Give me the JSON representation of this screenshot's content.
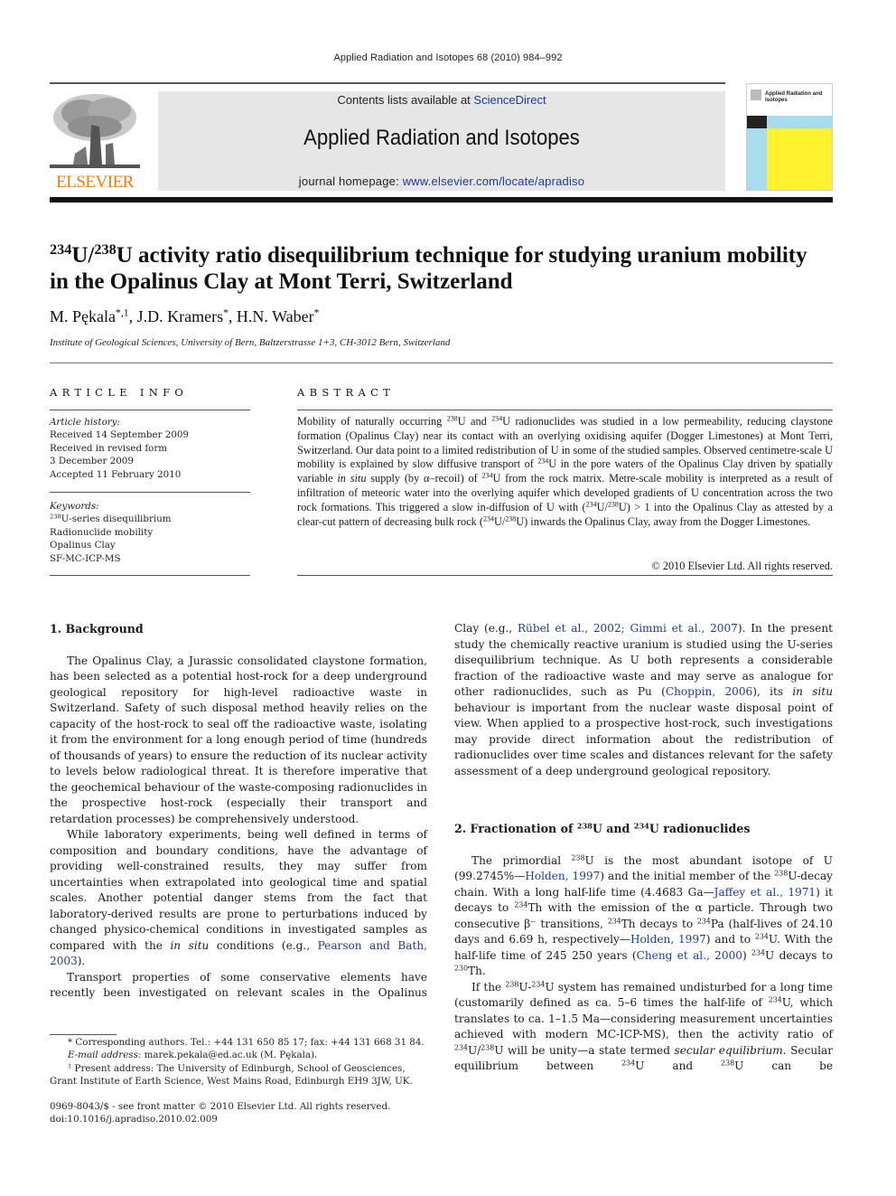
{
  "running_head": "Applied Radiation and Isotopes 68 (2010) 984–992",
  "masthead": {
    "publisher_logo_text": "ELSEVIER",
    "contents_prefix": "Contents lists available at ",
    "contents_link": "ScienceDirect",
    "journal_title": "Applied Radiation and Isotopes",
    "homepage_prefix": "journal homepage: ",
    "homepage_link": "www.elsevier.com/locate/apradiso",
    "cover_title": "Applied Radiation and Isotopes",
    "colors": {
      "elsevier_orange": "#f07d00",
      "link_blue": "#1f3a93",
      "banner_gray": "#e6e6e6",
      "cover_blue": "#a8dcef",
      "cover_yellow": "#fff22e"
    }
  },
  "article": {
    "title_sup1": "234",
    "title_u1": "U/",
    "title_sup2": "238",
    "title_rest": "U activity ratio disequilibrium technique for studying uranium mobility in the Opalinus Clay at Mont Terri, Switzerland",
    "authors": [
      {
        "name": "M. Pękala",
        "marks": "*,1"
      },
      {
        "name": "J.D. Kramers",
        "marks": "*"
      },
      {
        "name": "H.N. Waber",
        "marks": "*"
      }
    ],
    "affiliation": "Institute of Geological Sciences, University of Bern, Baltzerstrasse 1+3, CH-3012 Bern, Switzerland"
  },
  "article_info": {
    "heading": "ARTICLE INFO",
    "history_label": "Article history:",
    "history": [
      "Received 14 September 2009",
      "Received in revised form",
      "3 December 2009",
      "Accepted 11 February 2010"
    ],
    "keywords_label": "Keywords:",
    "keyword_sup": "238",
    "keywords": [
      "U-series disequilibrium",
      "Radionuclide mobility",
      "Opalinus Clay",
      "SF-MC-ICP-MS"
    ]
  },
  "abstract": {
    "heading": "ABSTRACT",
    "t1": "Mobility of naturally occurring ",
    "s1": "238",
    "t2": "U and ",
    "s2": "234",
    "t3": "U radionuclides was studied in a low permeability, reducing claystone formation (Opalinus Clay) near its contact with an overlying oxidising aquifer (Dogger Limestones) at Mont Terri, Switzerland. Our data point to a limited redistribution of U in some of the studied samples. Observed centimetre-scale U mobility is explained by slow diffusive transport of ",
    "s3": "234",
    "t4": "U in the pore waters of the Opalinus Clay driven by spatially variable ",
    "i1": "in situ",
    "t5": " supply (by α–recoil) of ",
    "s4": "234",
    "t6": "U from the rock matrix. Metre-scale mobility is interpreted as a result of infiltration of meteoric water into the overlying aquifer which developed gradients of U concentration across the two rock formations. This triggered a slow in-diffusion of U with (",
    "s5": "234",
    "t7": "U/",
    "s6": "238",
    "t8": "U) > 1 into the Opalinus Clay as attested by a clear-cut pattern of decreasing bulk rock (",
    "s7": "234",
    "t9": "U/",
    "s8": "238",
    "t10": "U) inwards the Opalinus Clay, away from the Dogger Limestones.",
    "copyright": "© 2010 Elsevier Ltd. All rights reserved."
  },
  "section1": {
    "heading": "1.  Background",
    "p1": "The Opalinus Clay, a Jurassic consolidated claystone formation, has been selected as a potential host-rock for a deep underground geological repository for high-level radioactive waste in Switzerland. Safety of such disposal method heavily relies on the capacity of the host-rock to seal off the radioactive waste, isolating it from the environment for a long enough period of time (hundreds of thousands of years) to ensure the reduction of its nuclear activity to levels below radiological threat. It is therefore imperative that the geochemical behaviour of the waste-composing radionuclides in the prospective host-rock (especially their transport and retardation processes) be comprehensively understood.",
    "p2a": "While laboratory experiments, being well defined in terms of composition and boundary conditions, have the advantage of providing well-constrained results, they may suffer from uncertainties when extrapolated into geological time and spatial scales. Another potential danger stems from the fact that laboratory-derived results are prone to perturbations induced by changed physico-chemical conditions in investigated samples as compared with the ",
    "p2_italic": "in situ",
    "p2b": " conditions (e.g., ",
    "p2_ref": "Pearson and Bath, 2003",
    "p2c": ").",
    "p3": "Transport properties of some conservative elements have recently been investigated on relevant scales in the Opalinus",
    "p3_cont_a": "Clay (e.g., ",
    "p3_ref1": "Rübel et al., 2002; Gimmi et al., 2007",
    "p3_cont_b": "). In the present study the chemically reactive uranium is studied using the U-series disequilibrium technique. As U both represents a considerable fraction of the radioactive waste and may serve as analogue for other radionuclides, such as Pu (",
    "p3_ref2": "Choppin, 2006",
    "p3_cont_c": "), its ",
    "p3_italic": "in situ",
    "p3_cont_d": " behaviour is important from the nuclear waste disposal point of view. When applied to a prospective host-rock, such investigations may provide direct information about the redistribution of radionuclides over time scales and distances relevant for the safety assessment of a deep underground geological repository."
  },
  "section2": {
    "heading_a": "2.  Fractionation of ",
    "heading_s1": "238",
    "heading_b": "U and ",
    "heading_s2": "234",
    "heading_c": "U radionuclides",
    "p1_a": "The primordial ",
    "p1_s1": "238",
    "p1_b": "U is the most abundant isotope of U (99.2745%—",
    "p1_ref1": "Holden, 1997",
    "p1_c": ") and the initial member of the ",
    "p1_s2": "238",
    "p1_d": "U-decay chain. With a long half-life time (4.4683 Ga—",
    "p1_ref2": "Jaffey et al., 1971",
    "p1_e": ") it decays to ",
    "p1_s3": "234",
    "p1_f": "Th with the emission of the α particle. Through two consecutive β⁻ transitions, ",
    "p1_s4": "234",
    "p1_g": "Th decays to ",
    "p1_s5": "234",
    "p1_h": "Pa (half-lives of 24.10 days and 6.69 h, respectively—",
    "p1_ref3": "Holden, 1997",
    "p1_i": ") and to ",
    "p1_s6": "234",
    "p1_j": "U. With the half-life time of 245 250 years (",
    "p1_ref4": "Cheng et al., 2000",
    "p1_k": ") ",
    "p1_s7": "234",
    "p1_l": "U decays to ",
    "p1_s8": "230",
    "p1_m": "Th.",
    "p2_a": "If the ",
    "p2_s1": "238",
    "p2_b": "U-",
    "p2_s2": "234",
    "p2_c": "U system has remained undisturbed for a long time (customarily defined as ca. 5–6 times the half-life of ",
    "p2_s3": "234",
    "p2_d": "U, which translates to ca. 1–1.5 Ma—considering measurement uncertainties achieved with modern MC-ICP-MS), then the activity ratio of ",
    "p2_s4": "234",
    "p2_e": "U/",
    "p2_s5": "238",
    "p2_f": "U will be unity—a state termed ",
    "p2_italic": "secular equilibrium",
    "p2_g": ". Secular equilibrium between ",
    "p2_s6": "234",
    "p2_h": "U and ",
    "p2_s7": "238",
    "p2_i": "U can be"
  },
  "footnotes": {
    "corresponding": "* Corresponding authors. Tel.: +44 131 650 85 17; fax: +44 131 668 31 84.",
    "email_label": "E-mail address:",
    "email": " marek.pekala@ed.ac.uk (M. Pękala).",
    "present_sup": "1",
    "present": " Present address: The University of Edinburgh, School of Geosciences, Grant Institute of Earth Science, West Mains Road, Edinburgh EH9 3JW, UK.",
    "issn": "0969-8043/$ - see front matter © 2010 Elsevier Ltd. All rights reserved.",
    "doi": "doi:10.1016/j.apradiso.2010.02.009"
  }
}
